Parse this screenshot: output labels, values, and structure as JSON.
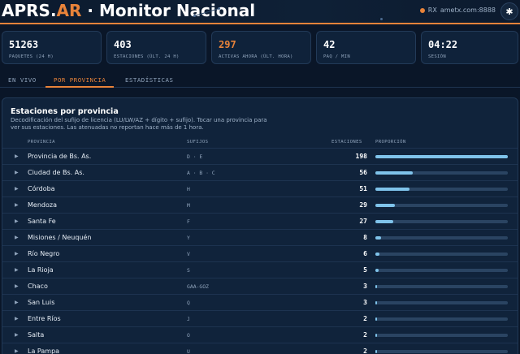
{
  "header": {
    "title_aprs": "APRS.",
    "title_ar": "AR",
    "title_rest": " · Monitor Nacional",
    "rx_label": "RX",
    "rx_host": "ametx.com:8888",
    "settings_icon": "gear-icon"
  },
  "stats": [
    {
      "value": "51263",
      "label": "PAQUETES (24 H)",
      "accent": false
    },
    {
      "value": "403",
      "label": "ESTACIONES (ÚLT. 24 H)",
      "accent": false
    },
    {
      "value": "297",
      "label": "ACTIVAS AHORA (ÚLT. HORA)",
      "accent": true
    },
    {
      "value": "42",
      "label": "PAQ / MIN",
      "accent": false
    },
    {
      "value": "04:22",
      "label": "SESIÓN",
      "accent": false
    }
  ],
  "tabs": [
    {
      "label": "EN VIVO",
      "active": false
    },
    {
      "label": "POR PROVINCIA",
      "active": true
    },
    {
      "label": "ESTADÍSTICAS",
      "active": false
    }
  ],
  "panel": {
    "title": "Estaciones por provincia",
    "description": "Decodificación del sufijo de licencia (LU/LW/AZ + dígito + sufijo). Tocar una provincia para ver sus estaciones. Las atenuadas no reportan hace más de 1 hora.",
    "columns": {
      "province": "PROVINCIA",
      "suffixes": "SUFIJOS",
      "stations": "ESTACIONES",
      "proportion": "PROPORCIÓN"
    },
    "max_count": 198,
    "rows": [
      {
        "province": "Provincia de Bs. As.",
        "suffixes": "D · E",
        "count": "198",
        "value": 198
      },
      {
        "province": "Ciudad de Bs. As.",
        "suffixes": "A · B · C",
        "count": "56",
        "value": 56
      },
      {
        "province": "Córdoba",
        "suffixes": "H",
        "count": "51",
        "value": 51
      },
      {
        "province": "Mendoza",
        "suffixes": "M",
        "count": "29",
        "value": 29
      },
      {
        "province": "Santa Fe",
        "suffixes": "F",
        "count": "27",
        "value": 27
      },
      {
        "province": "Misiones / Neuquén",
        "suffixes": "Y",
        "count": "8",
        "value": 8
      },
      {
        "province": "Río Negro",
        "suffixes": "V",
        "count": "6",
        "value": 6
      },
      {
        "province": "La Rioja",
        "suffixes": "S",
        "count": "5",
        "value": 5
      },
      {
        "province": "Chaco",
        "suffixes": "GAA-GOZ",
        "count": "3",
        "value": 3
      },
      {
        "province": "San Luis",
        "suffixes": "Q",
        "count": "3",
        "value": 3
      },
      {
        "province": "Entre Ríos",
        "suffixes": "J",
        "count": "2",
        "value": 2
      },
      {
        "province": "Salta",
        "suffixes": "O",
        "count": "2",
        "value": 2
      },
      {
        "province": "La Pampa",
        "suffixes": "U",
        "count": "2",
        "value": 2
      }
    ]
  },
  "colors": {
    "accent": "#e8833a",
    "bar": "#7fc3ea",
    "background": "#0a1628"
  }
}
